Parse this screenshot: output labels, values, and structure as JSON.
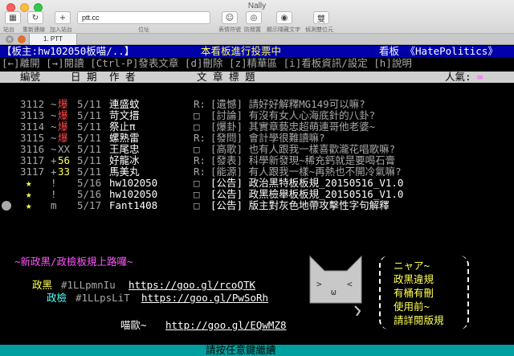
{
  "window": {
    "title": "Nally"
  },
  "toolbar": {
    "buttons": [
      {
        "label": "站台",
        "icon": "sites-icon"
      },
      {
        "label": "重新連線",
        "icon": "reconnect-icon"
      },
      {
        "label": "加入站台",
        "icon": "add-site-icon"
      },
      {
        "label": "表情符號",
        "icon": "emoticon-icon"
      },
      {
        "label": "防閒置",
        "icon": "anti-idle-icon"
      },
      {
        "label": "顯示隱藏文字",
        "icon": "show-hidden-text-icon"
      },
      {
        "label": "偵測雙位元",
        "icon": "double-byte-icon"
      }
    ],
    "address_label": "位址",
    "address_value": "ptt.cc"
  },
  "tabs": [
    {
      "label": "1. PTT"
    }
  ],
  "board_header": {
    "moderator": "【板主:hw102050板喵/..】",
    "notice": "本看板進行投票中",
    "board": "看板 《HatePolitics》"
  },
  "help_bar": "[←]離開 [→]閱讀 [Ctrl-P]發表文章 [d]刪除 [z]精華區 [i]看板資訊/設定 [h]說明",
  "columns": {
    "number": "編號",
    "date": "日 期",
    "author": "作 者",
    "title": "文 章 標 題",
    "popularity": "人氣:",
    "popularity_value": "∞"
  },
  "posts": [
    {
      "num": "3112",
      "mark": "~",
      "push": "爆",
      "date": "5/11",
      "author": "連盛蚊",
      "prefix": "R:",
      "title": "[遺憾] 請好好解釋MG149可以嘛?"
    },
    {
      "num": "3113",
      "mark": "~",
      "push": "爆",
      "date": "5/11",
      "author": "苛文搢",
      "prefix": "□",
      "title": "[討論] 有沒有女人心海底針的八卦?"
    },
    {
      "num": "3114",
      "mark": "~",
      "push": "爆",
      "date": "5/11",
      "author": "祭止π",
      "prefix": "□",
      "title": "[爆卦] 其實章藝忠超萌連哥他老婆~"
    },
    {
      "num": "3115",
      "mark": "~",
      "push": "爆",
      "date": "5/11",
      "author": "螺熟雷",
      "prefix": "R:",
      "title": "[發問] 會計學很難讀嘛?"
    },
    {
      "num": "3116",
      "mark": "~",
      "push": "XX",
      "date": "5/11",
      "author": "王尾忠",
      "prefix": "□",
      "title": "[高歌] 也有人跟我一樣喜歡瀧花唱歌嘛?"
    },
    {
      "num": "3117",
      "mark": "+",
      "push": "56",
      "date": "5/11",
      "author": "好龍冰",
      "prefix": "R:",
      "title": "[發表] 科學新發現~稀充鈣就是要喝石膏"
    },
    {
      "num": "3117",
      "mark": "+",
      "push": "33",
      "date": "5/11",
      "author": "馬美丸",
      "prefix": "R:",
      "title": "[能源] 有人跟我一樣~再熱也不開冷氣嘛?"
    },
    {
      "num": "★",
      "mark": "!",
      "push": "",
      "date": "5/16",
      "author": "hw102050",
      "prefix": "□",
      "title": "[公告] 政治黑特板板規_20150516_V1.0"
    },
    {
      "num": "★",
      "mark": "!",
      "push": "",
      "date": "5/16",
      "author": "hw102050",
      "prefix": "□",
      "title": "[公告] 政黑檢舉板板規_20150516_V1.0"
    },
    {
      "num": "★",
      "mark": "m",
      "push": "",
      "date": "5/17",
      "author": "Fant1408",
      "prefix": "□",
      "title": "[公告] 版主對灰色地帶攻擊性字句解釋"
    }
  ],
  "promo": {
    "headline": "~新政黑/政檢板規上路囉~",
    "line1_label": "政黑",
    "line1_code": "#1LLpmnIu",
    "line1_url": "https://goo.gl/rcoQTK",
    "line2_label": "政檢",
    "line2_code": "#1LLpsLiT",
    "line2_url": "https://goo.gl/PwSoRh",
    "line3_label": "喵歐~",
    "line3_url": "http://goo.gl/EQwMZ8"
  },
  "cat_bubble": [
    "ニャア~",
    "政黑違規",
    "有桶有刪",
    "使用前~",
    "請詳閱版規"
  ],
  "footer": "請按任意鍵繼續",
  "colors": {
    "header_blue": "#0000aa",
    "footer_cyan": "#00a0a0",
    "push_red": "#ff4444",
    "push_yellow": "#ffff55"
  }
}
